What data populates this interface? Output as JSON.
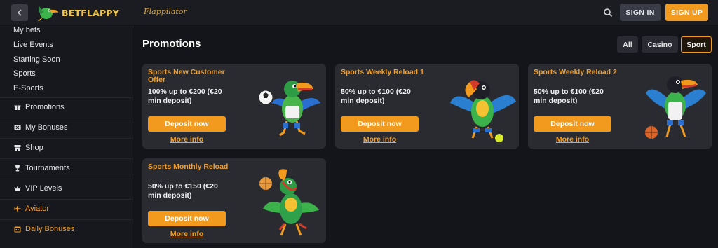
{
  "header": {
    "logo_text": "BETFLAPPY",
    "secondary_logo": "Flappilator",
    "signin_label": "SIGN IN",
    "signup_label": "SIGN UP"
  },
  "sidebar": {
    "links": [
      "My bets",
      "Live Events",
      "Starting Soon",
      "Sports",
      "E-Sports"
    ],
    "items": [
      {
        "label": "Promotions",
        "icon": "gift-icon"
      },
      {
        "label": "My Bonuses",
        "icon": "bonus-icon"
      },
      {
        "label": "Shop",
        "icon": "shop-icon"
      },
      {
        "label": "Tournaments",
        "icon": "trophy-icon"
      },
      {
        "label": "VIP Levels",
        "icon": "crown-icon"
      },
      {
        "label": "Aviator",
        "icon": "plane-icon"
      },
      {
        "label": "Daily Bonuses",
        "icon": "calendar-icon"
      }
    ]
  },
  "main": {
    "title": "Promotions",
    "filters": [
      "All",
      "Casino",
      "Sport"
    ],
    "active_filter": "Sport"
  },
  "promotions": [
    {
      "title": "Sports New Customer Offer",
      "description": "100% up to €200 (€20 min deposit)",
      "button": "Deposit now",
      "more": "More info",
      "art": "toucan-soccer-icon"
    },
    {
      "title": "Sports Weekly Reload 1",
      "description": "50% up to €100 (€20 min deposit)",
      "button": "Deposit now",
      "more": "More info",
      "art": "toucan-tennis-icon"
    },
    {
      "title": "Sports Weekly Reload 2",
      "description": "50% up to €100 (€20 min deposit)",
      "button": "Deposit now",
      "more": "More info",
      "art": "toucan-basketball-icon"
    },
    {
      "title": "Sports Monthly Reload",
      "description": "50% up to €150 (€20 min deposit)",
      "button": "Deposit now",
      "more": "More info",
      "art": "toucan-volleyball-icon"
    }
  ],
  "colors": {
    "accent": "#f29a1d",
    "background": "#14151a",
    "card": "#2a2b31",
    "title_orange": "#f2a12a"
  }
}
